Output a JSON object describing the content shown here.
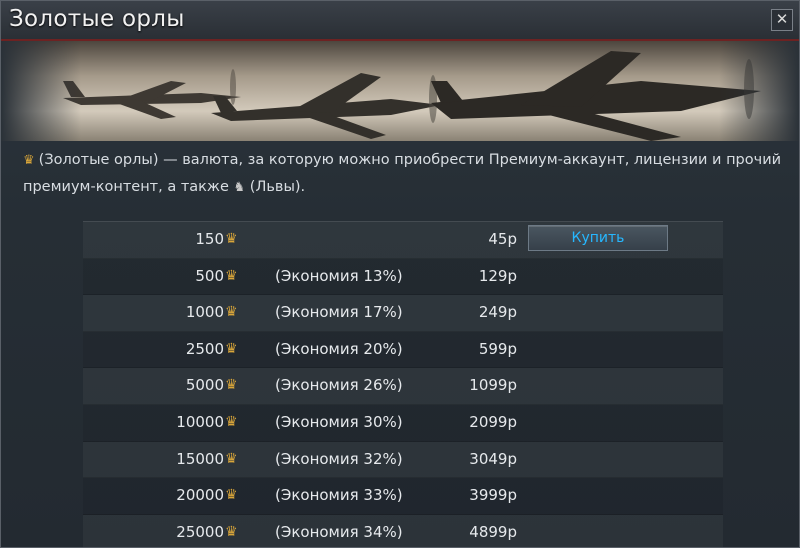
{
  "window": {
    "title": "Золотые орлы",
    "close_icon": "close-icon"
  },
  "description": {
    "eagle_icon": "golden-eagle-icon",
    "text_part1": "(Золотые орлы) — валюта, за которую можно приобрести Премиум-аккаунт, лицензии и прочий премиум-контент, а также",
    "lion_icon": "lion-icon",
    "text_part2": "(Львы)."
  },
  "table": {
    "buy_label": "Купить",
    "rows": [
      {
        "amount": "150",
        "saving": "",
        "price": "45р",
        "buy": true
      },
      {
        "amount": "500",
        "saving": "(Экономия 13%)",
        "price": "129р",
        "buy": false
      },
      {
        "amount": "1000",
        "saving": "(Экономия 17%)",
        "price": "249р",
        "buy": false
      },
      {
        "amount": "2500",
        "saving": "(Экономия 20%)",
        "price": "599р",
        "buy": false
      },
      {
        "amount": "5000",
        "saving": "(Экономия 26%)",
        "price": "1099р",
        "buy": false
      },
      {
        "amount": "10000",
        "saving": "(Экономия 30%)",
        "price": "2099р",
        "buy": false
      },
      {
        "amount": "15000",
        "saving": "(Экономия 32%)",
        "price": "3049р",
        "buy": false
      },
      {
        "amount": "20000",
        "saving": "(Экономия 33%)",
        "price": "3999р",
        "buy": false
      },
      {
        "amount": "25000",
        "saving": "(Экономия 34%)",
        "price": "4899р",
        "buy": false
      }
    ]
  },
  "colors": {
    "accent_blue": "#26b7ff",
    "gold": "#d9a63a",
    "title_underline": "#6d2222"
  }
}
